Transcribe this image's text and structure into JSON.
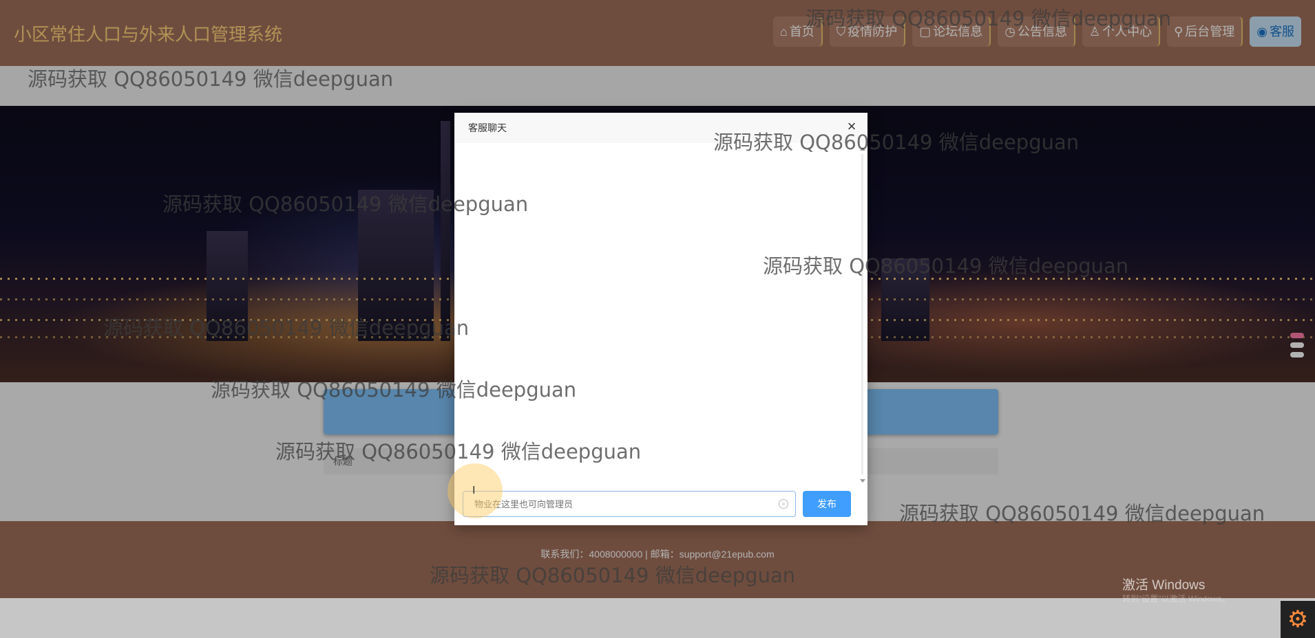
{
  "header": {
    "site_title": "小区常住人口与外来人口管理系统",
    "nav": [
      {
        "icon": "⌂",
        "label": "首页"
      },
      {
        "icon": "⛉",
        "label": "疫情防护"
      },
      {
        "icon": "▢",
        "label": "论坛信息"
      },
      {
        "icon": "◷",
        "label": "公告信息"
      },
      {
        "icon": "♙",
        "label": "个人中心"
      },
      {
        "icon": "⚲",
        "label": "后台管理"
      },
      {
        "icon": "◉",
        "label": "客服"
      }
    ]
  },
  "main": {
    "table_header": "标题"
  },
  "footer": {
    "contact": "联系我们：4008000000 | 邮箱：support@21epub.com"
  },
  "chat": {
    "title": "客服聊天",
    "input_placeholder": "物业在这里也可向管理员",
    "send_label": "发布",
    "close_glyph": "×"
  },
  "watermarks": [
    "源码获取 QQ86050149 微信deepguan",
    "源码获取 QQ86050149 微信deepguan",
    "源码获取 QQ86050149 微信deepguan",
    "源码获取 QQ86050149 微信deepguan",
    "源码获取 QQ86050149 微信deepguan",
    "源码获取 QQ86050149 微信deepguan",
    "源码获取 QQ86050149 微信deepguan",
    "源码获取 QQ86050149 微信deepguan",
    "源码获取 QQ86050149 微信deepguan",
    "源码获取 QQ86050149 微信deepguan"
  ],
  "os": {
    "activate_windows": "激活 Windows",
    "activate_hint": "转到\"设置\"以激活 Windows。"
  },
  "colors": {
    "header_bg": "#9f6f5a",
    "title_color": "#ffd27a",
    "send_button": "#409eff"
  }
}
